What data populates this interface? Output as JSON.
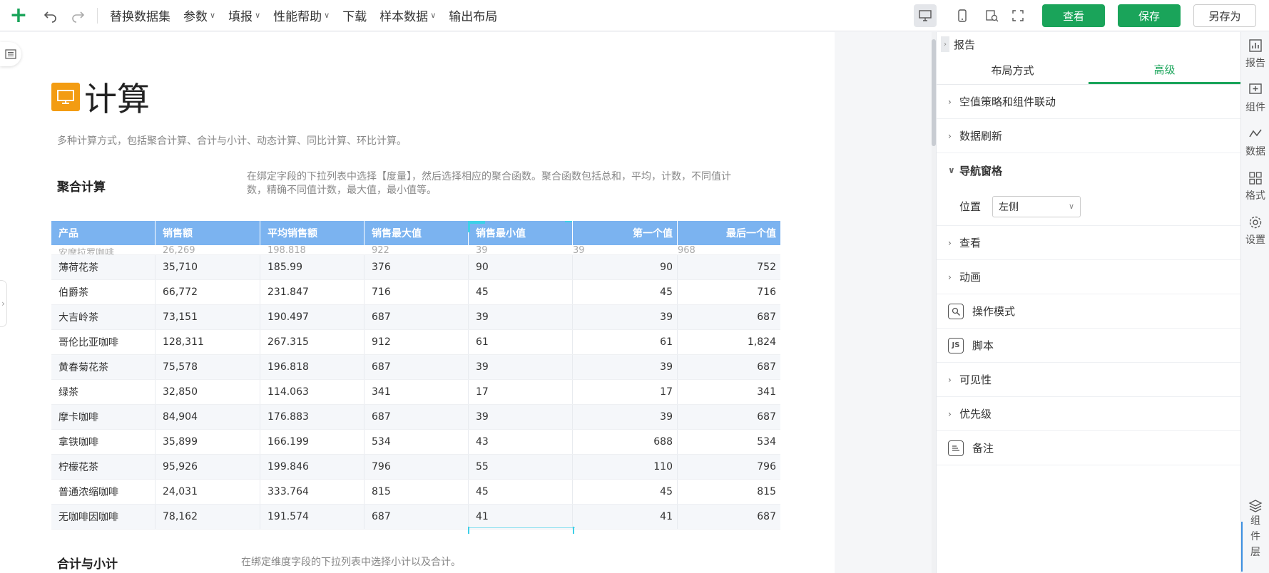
{
  "toolbar": {
    "menu": [
      {
        "label": "替换数据集",
        "caret": false
      },
      {
        "label": "参数",
        "caret": true
      },
      {
        "label": "填报",
        "caret": true
      },
      {
        "label": "性能帮助",
        "caret": true
      },
      {
        "label": "下载",
        "caret": false
      },
      {
        "label": "样本数据",
        "caret": true
      },
      {
        "label": "输出布局",
        "caret": false
      }
    ],
    "view_label": "查看",
    "save_label": "保存",
    "save_as_label": "另存为"
  },
  "page": {
    "title": "计算",
    "subtitle": "多种计算方式，包括聚合计算、合计与小计、动态计算、同比计算、环比计算。",
    "section1": {
      "title": "聚合计算",
      "desc_line1": "在绑定字段的下拉列表中选择【度量】，然后选择相应的聚合函数。聚合函数包括总和，平均，计数，不同值计",
      "desc_line2": "数，精确不同值计数，最大值，最小值等。"
    },
    "section2": {
      "title": "合计与小计",
      "desc": "在绑定维度字段的下拉列表中选择小计以及合计。"
    }
  },
  "table": {
    "headers": [
      "产品",
      "销售额",
      "平均销售额",
      "销售最大值",
      "销售最小值",
      "第一个值",
      "最后一个值"
    ],
    "cut_row": [
      "安摩拉罗咖啡",
      "26,269",
      "198.818",
      "922",
      "39",
      "39",
      "968"
    ],
    "rows": [
      [
        "薄荷花茶",
        "35,710",
        "185.99",
        "376",
        "90",
        "90",
        "752"
      ],
      [
        "伯爵茶",
        "66,772",
        "231.847",
        "716",
        "45",
        "45",
        "716"
      ],
      [
        "大吉岭茶",
        "73,151",
        "190.497",
        "687",
        "39",
        "39",
        "687"
      ],
      [
        "哥伦比亚咖啡",
        "128,311",
        "267.315",
        "912",
        "61",
        "61",
        "1,824"
      ],
      [
        "黄春菊花茶",
        "75,578",
        "196.818",
        "687",
        "39",
        "39",
        "687"
      ],
      [
        "绿茶",
        "32,850",
        "114.063",
        "341",
        "17",
        "17",
        "341"
      ],
      [
        "摩卡咖啡",
        "84,904",
        "176.883",
        "687",
        "39",
        "39",
        "687"
      ],
      [
        "拿铁咖啡",
        "35,899",
        "166.199",
        "534",
        "43",
        "688",
        "534"
      ],
      [
        "柠檬花茶",
        "95,926",
        "199.846",
        "796",
        "55",
        "110",
        "796"
      ],
      [
        "普通浓缩咖啡",
        "24,031",
        "333.764",
        "815",
        "45",
        "45",
        "815"
      ],
      [
        "无咖啡因咖啡",
        "78,162",
        "191.574",
        "687",
        "41",
        "41",
        "687"
      ]
    ]
  },
  "panel": {
    "header": "报告",
    "tabs": [
      "布局方式",
      "高级"
    ],
    "props": {
      "null_policy": "空值策略和组件联动",
      "data_refresh": "数据刷新",
      "nav_pane": "导航窗格",
      "position_label": "位置",
      "position_value": "左侧",
      "view": "查看",
      "animation": "动画",
      "op_mode": "操作模式",
      "script": "脚本",
      "script_icon": "JS",
      "visibility": "可见性",
      "priority": "优先级",
      "note": "备注"
    }
  },
  "rail": {
    "report": "报告",
    "component": "组件",
    "data": "数据",
    "format": "格式",
    "settings": "设置",
    "layers": [
      "组",
      "件",
      "层"
    ]
  },
  "colors": {
    "accent_green": "#1aa45a",
    "table_header": "#7bb3f0",
    "title_icon": "#f39c12"
  }
}
